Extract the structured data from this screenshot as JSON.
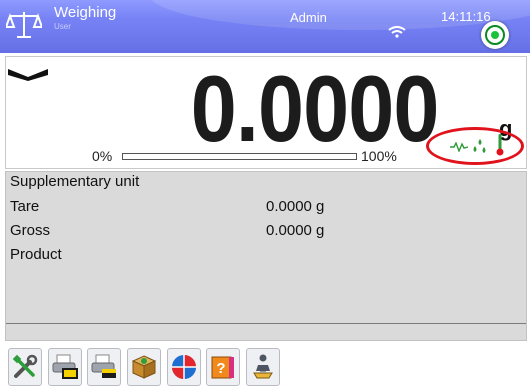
{
  "header": {
    "app_title": "Weighing",
    "app_subtitle": "User",
    "user": "Admin",
    "time": "14:11:16",
    "logo_icon": "scale-icon",
    "wifi_icon": "wifi-icon",
    "status_icon": "status-ok-icon",
    "colors": {
      "bar": "#7783f5",
      "status": "#19c43a"
    }
  },
  "display": {
    "weight": "0.0000",
    "unit": "g",
    "bar_min_label": "0%",
    "bar_max_label": "100%",
    "bar_level_percent": 0,
    "stability_icon": "stability-marker-icon",
    "indicator_icons": [
      "vibration-icon",
      "humidity-drops-icon",
      "thermometer-icon"
    ],
    "highlight_color": "#e0121b"
  },
  "info": {
    "rows": [
      {
        "label": "Supplementary unit",
        "value": ""
      },
      {
        "label": "Tare",
        "value": "0.0000 g"
      },
      {
        "label": "Gross",
        "value": "0.0000 g"
      },
      {
        "label": "Product",
        "value": ""
      }
    ]
  },
  "toolbar": {
    "buttons": [
      {
        "icon": "tools-icon"
      },
      {
        "icon": "printer-header-icon"
      },
      {
        "icon": "printer-footer-icon"
      },
      {
        "icon": "product-box-icon"
      },
      {
        "icon": "pie-chart-icon"
      },
      {
        "icon": "help-book-icon"
      },
      {
        "icon": "scale-profile-icon"
      }
    ]
  }
}
